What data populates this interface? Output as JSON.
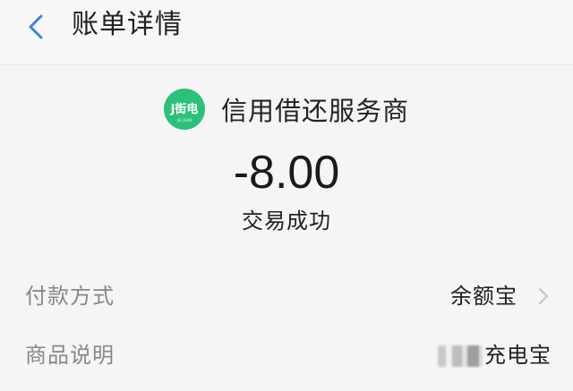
{
  "header": {
    "title": "账单详情",
    "back_icon": "chevron-left-icon",
    "accent_color": "#3b82e0"
  },
  "merchant": {
    "logo_text": "J街电",
    "logo_sub": "JIE DIAN",
    "logo_color": "#2cc07a",
    "name": "信用借还服务商"
  },
  "transaction": {
    "amount": "-8.00",
    "status": "交易成功"
  },
  "details": [
    {
      "label": "付款方式",
      "value": "余额宝",
      "has_chevron": true
    },
    {
      "label": "商品说明",
      "value": "充电宝",
      "has_chevron": false,
      "value_prefix_obscured": true
    }
  ]
}
